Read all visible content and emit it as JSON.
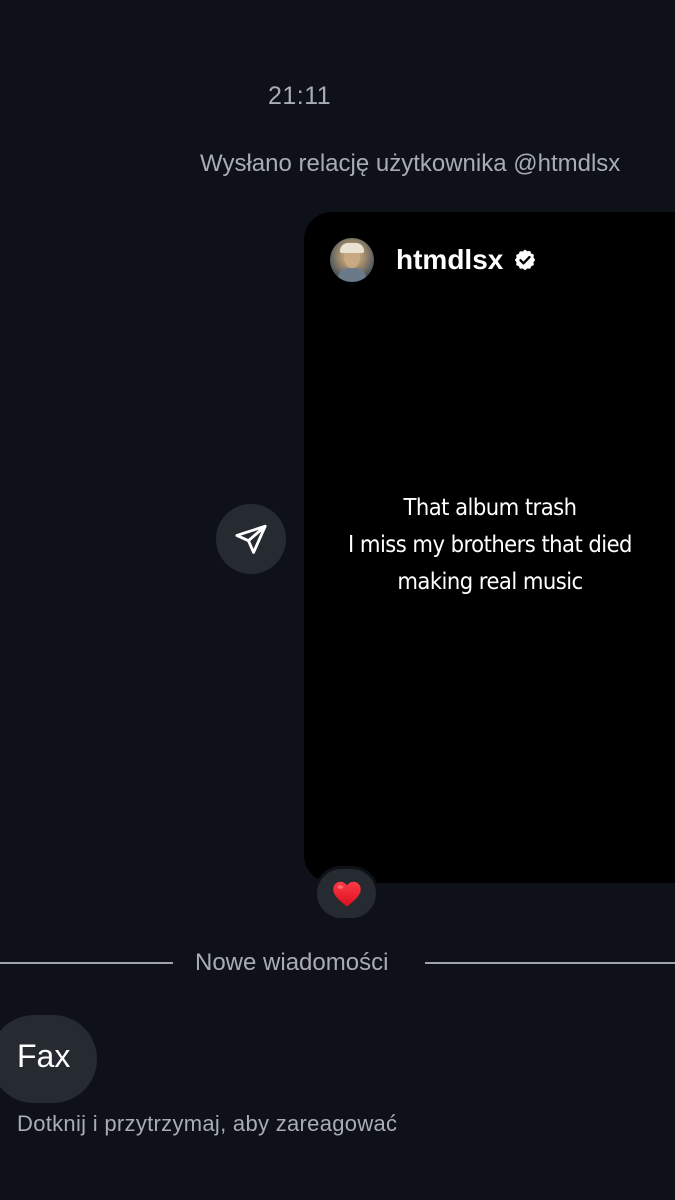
{
  "thread": {
    "timestamp": "21:11",
    "story_caption": "Wysłano relację użytkownika @htmdlsx"
  },
  "story": {
    "username": "htmdlsx",
    "verified": true,
    "text_lines": [
      "That album trash",
      "I miss my brothers that died",
      "making real music"
    ],
    "reaction_emoji": "❤️"
  },
  "divider": {
    "label": "Nowe wiadomości"
  },
  "message": {
    "text": "Fax",
    "hint": "Dotknij i przytrzymaj, aby zareagować"
  },
  "icons": {
    "share": "paper-plane-icon",
    "verified": "verified-badge-icon",
    "reaction": "red-heart-emoji"
  },
  "colors": {
    "background": "#0e1118",
    "bubble": "#262a31",
    "secondary_text": "#a8acb5",
    "story_background": "#000000"
  }
}
